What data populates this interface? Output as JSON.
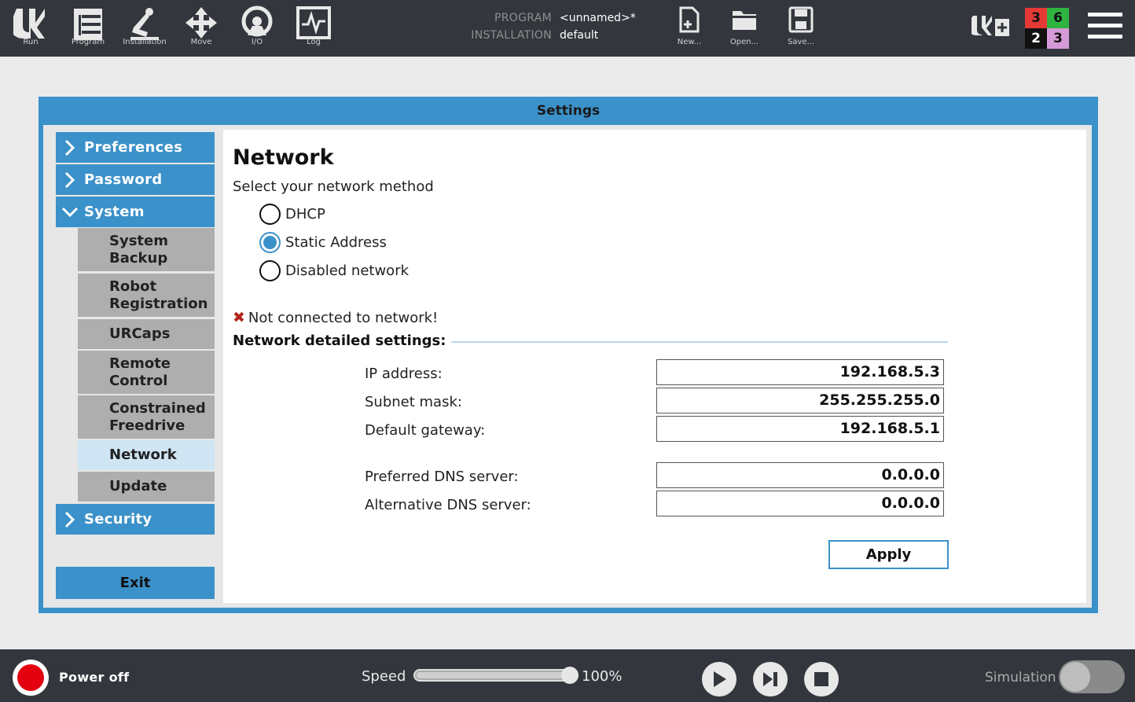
{
  "topbar": {
    "tabs": [
      {
        "label": "Run",
        "icon": "ur-logo-icon"
      },
      {
        "label": "Program",
        "icon": "program-icon"
      },
      {
        "label": "Installation",
        "icon": "installation-icon"
      },
      {
        "label": "Move",
        "icon": "move-icon"
      },
      {
        "label": "I/O",
        "icon": "io-icon"
      },
      {
        "label": "Log",
        "icon": "log-icon"
      }
    ],
    "program_key": "PROGRAM",
    "program_value": "<unnamed>*",
    "installation_key": "INSTALLATION",
    "installation_value": "default",
    "file_buttons": [
      {
        "label": "New...",
        "icon": "new-file-icon"
      },
      {
        "label": "Open...",
        "icon": "folder-icon"
      },
      {
        "label": "Save...",
        "icon": "save-icon"
      }
    ],
    "counters": [
      {
        "value": "3",
        "bg": "#e53935",
        "fg": "#111111"
      },
      {
        "value": "6",
        "bg": "#2fb341",
        "fg": "#111111"
      },
      {
        "value": "2",
        "bg": "#111111",
        "fg": "#ffffff"
      },
      {
        "value": "3",
        "bg": "#d79ad8",
        "fg": "#111111"
      }
    ]
  },
  "dialog": {
    "title": "Settings",
    "nav": {
      "preferences": "Preferences",
      "password": "Password",
      "system": "System",
      "system_items": [
        {
          "line1": "System",
          "line2": "Backup"
        },
        {
          "line1": "Robot",
          "line2": "Registration"
        },
        {
          "line1": "URCaps",
          "line2": ""
        },
        {
          "line1": "Remote",
          "line2": "Control"
        },
        {
          "line1": "Constrained",
          "line2": "Freedrive"
        },
        {
          "line1": "Network",
          "line2": ""
        },
        {
          "line1": "Update",
          "line2": ""
        }
      ],
      "security": "Security",
      "exit": "Exit"
    },
    "network": {
      "title": "Network",
      "method_label": "Select your network method",
      "options": [
        "DHCP",
        "Static Address",
        "Disabled network"
      ],
      "selected": "Static Address",
      "status": "Not connected to network!",
      "detail_heading": "Network detailed settings:",
      "fields": {
        "ip_label": "IP address:",
        "ip_value": "192.168.5.3",
        "subnet_label": "Subnet mask:",
        "subnet_value": "255.255.255.0",
        "gateway_label": "Default gateway:",
        "gateway_value": "192.168.5.1",
        "dns1_label": "Preferred DNS server:",
        "dns1_value": "0.0.0.0",
        "dns2_label": "Alternative DNS server:",
        "dns2_value": "0.0.0.0"
      },
      "apply": "Apply"
    }
  },
  "bottombar": {
    "power": "Power off",
    "speed_label": "Speed",
    "speed_value": "100%",
    "speed_fraction": 1.0,
    "simulation_label": "Simulation",
    "simulation_on": false
  },
  "colors": {
    "accent": "#3b91c9",
    "bar": "#33373d",
    "selected_nav": "#cfe5f4",
    "sub_nav": "#aeaeae",
    "power": "#e3000f"
  }
}
